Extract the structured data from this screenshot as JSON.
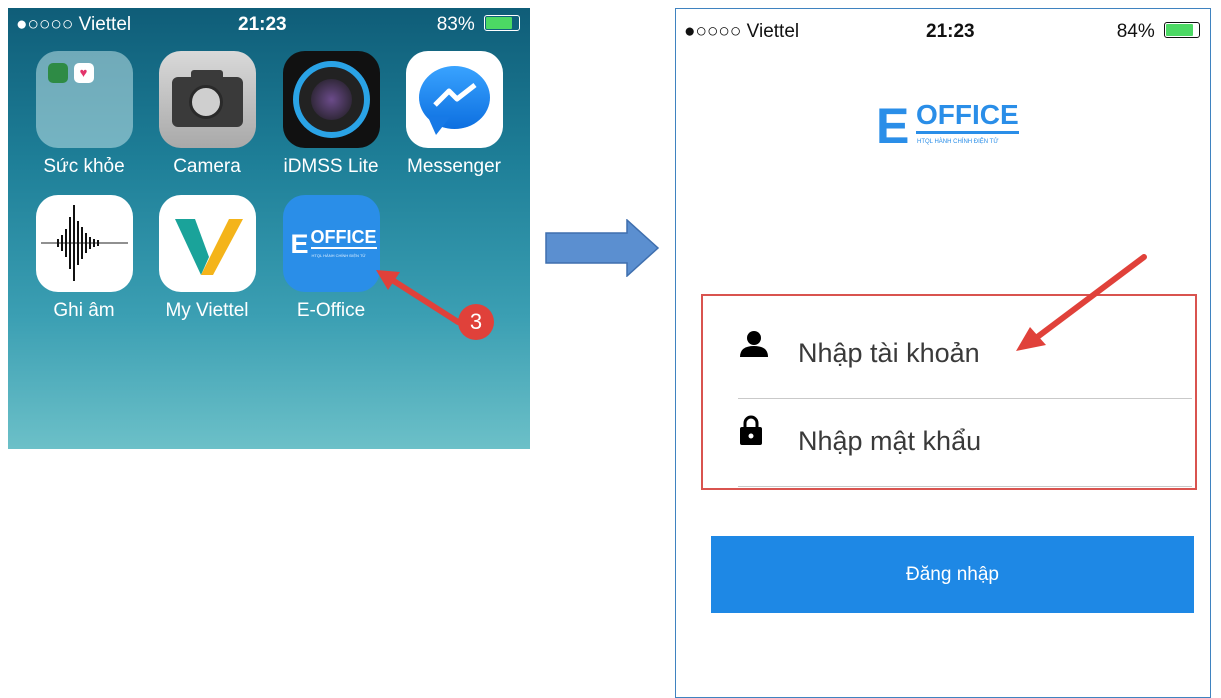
{
  "home": {
    "status": {
      "carrier": "●○○○○ Viettel",
      "time": "21:23",
      "battery": "83%"
    },
    "apps": [
      {
        "label": "Sức khỏe",
        "icon": "health-folder-icon"
      },
      {
        "label": "Camera",
        "icon": "camera-icon"
      },
      {
        "label": "iDMSS Lite",
        "icon": "idmss-icon"
      },
      {
        "label": "Messenger",
        "icon": "messenger-icon"
      },
      {
        "label": "Ghi âm",
        "icon": "voice-memo-icon"
      },
      {
        "label": "My Viettel",
        "icon": "my-viettel-icon"
      },
      {
        "label": "E-Office",
        "icon": "eoffice-icon"
      }
    ],
    "eoffice_logo": {
      "letter": "E",
      "word": "OFFICE",
      "tagline": "HTQL HÀNH CHÍNH ĐIỆN TỬ"
    },
    "step_badge": "3"
  },
  "login": {
    "status": {
      "carrier": "●○○○○ Viettel",
      "time": "21:23",
      "battery": "84%"
    },
    "logo": {
      "letter": "E",
      "word": "OFFICE",
      "tagline": "HTQL HÀNH CHÍNH ĐIỆN TỬ"
    },
    "username_placeholder": "Nhập tài khoản",
    "password_placeholder": "Nhập mật khẩu",
    "submit_label": "Đăng nhập"
  },
  "colors": {
    "accent": "#1e88e5",
    "annotation": "#e0413a",
    "arrow": "#5b8fd0"
  }
}
